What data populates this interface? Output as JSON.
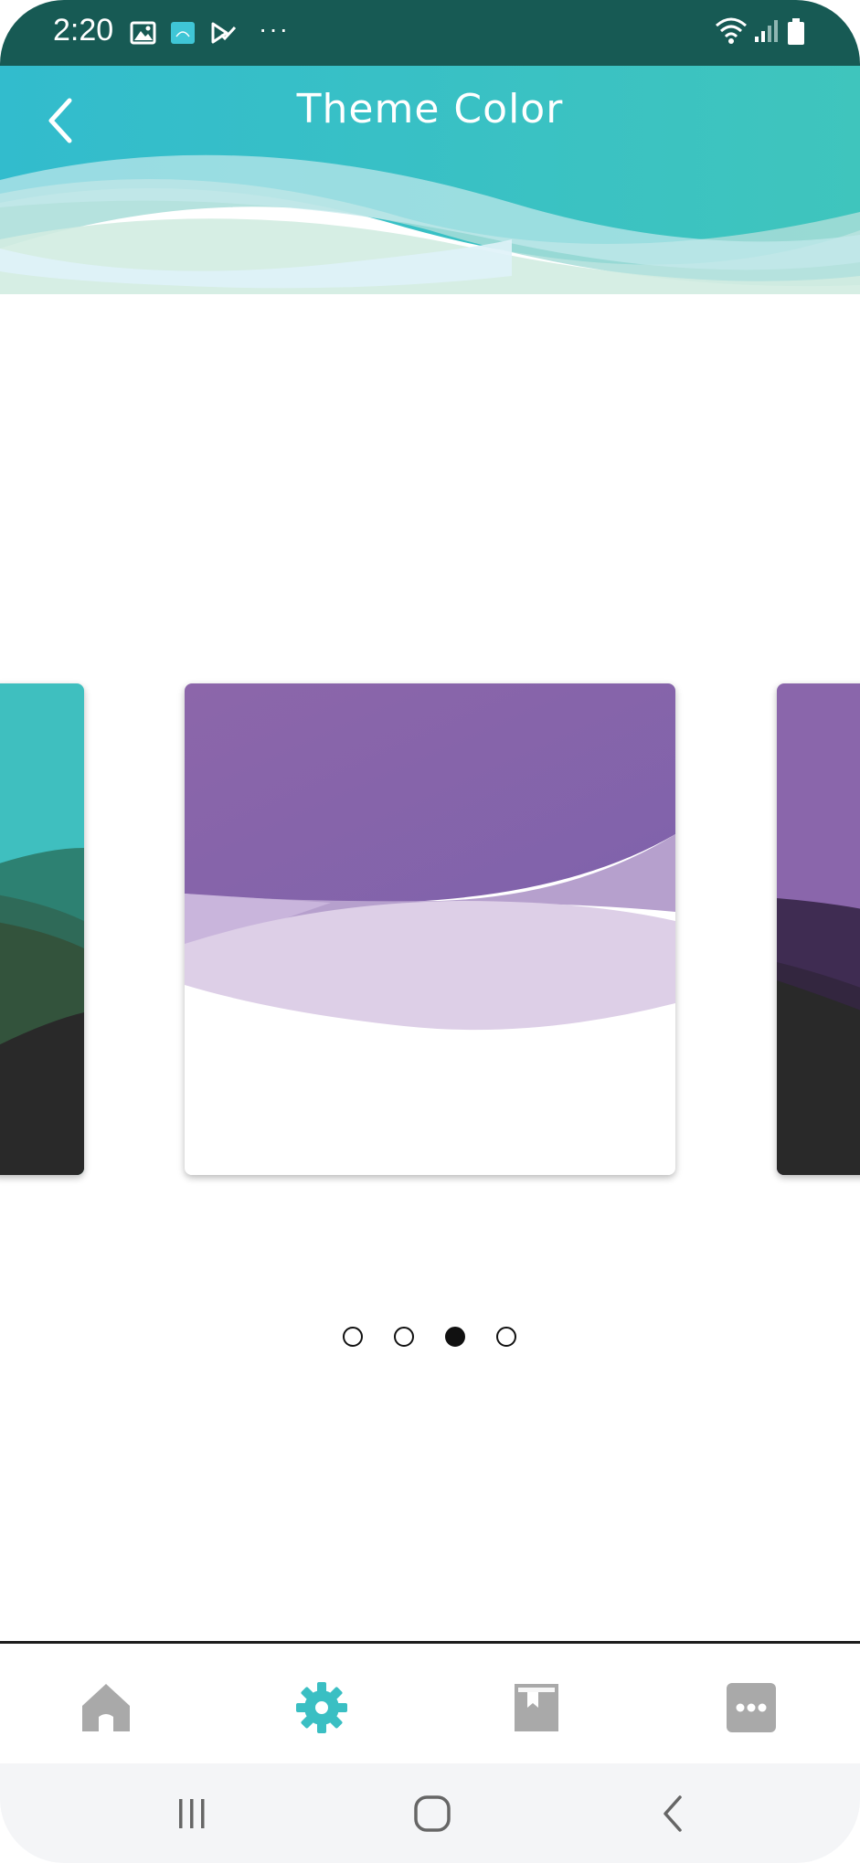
{
  "status_bar": {
    "time": "2:20",
    "left_icons": [
      "gallery-icon",
      "photo-app-icon",
      "tasks-icon",
      "more-dots-icon"
    ],
    "right_icons": [
      "wifi-icon",
      "signal-icon",
      "battery-icon"
    ],
    "more_indicator": "···"
  },
  "header": {
    "title": "Theme Color",
    "back_icon": "chevron-left-icon"
  },
  "theme_cards": [
    {
      "name": "teal-theme",
      "colors": [
        "#3fbfbf",
        "#2b7a6a",
        "#34543c",
        "#282828"
      ]
    },
    {
      "name": "purple-theme",
      "colors": [
        "#8a66ab",
        "#c7b1da",
        "#ddcfe7",
        "#ffffff"
      ]
    },
    {
      "name": "dark-purple-theme",
      "colors": [
        "#8a66ab",
        "#3f2c52",
        "#282828"
      ]
    }
  ],
  "pager": {
    "count": 4,
    "active_index": 2
  },
  "bottom_nav": {
    "items": [
      {
        "name": "home",
        "icon": "home-icon",
        "active": false
      },
      {
        "name": "settings",
        "icon": "gear-icon",
        "active": true
      },
      {
        "name": "bookmarks",
        "icon": "bookmark-book-icon",
        "active": false
      },
      {
        "name": "more",
        "icon": "more-icon",
        "active": false
      }
    ]
  },
  "system_nav": {
    "items": [
      "recent-apps-icon",
      "home-circle-icon",
      "back-icon"
    ]
  },
  "colors": {
    "accent": "#3abfc3",
    "status_bar": "#175a54",
    "nav_inactive": "#a9a9a9",
    "nav_active": "#3abfc3"
  }
}
